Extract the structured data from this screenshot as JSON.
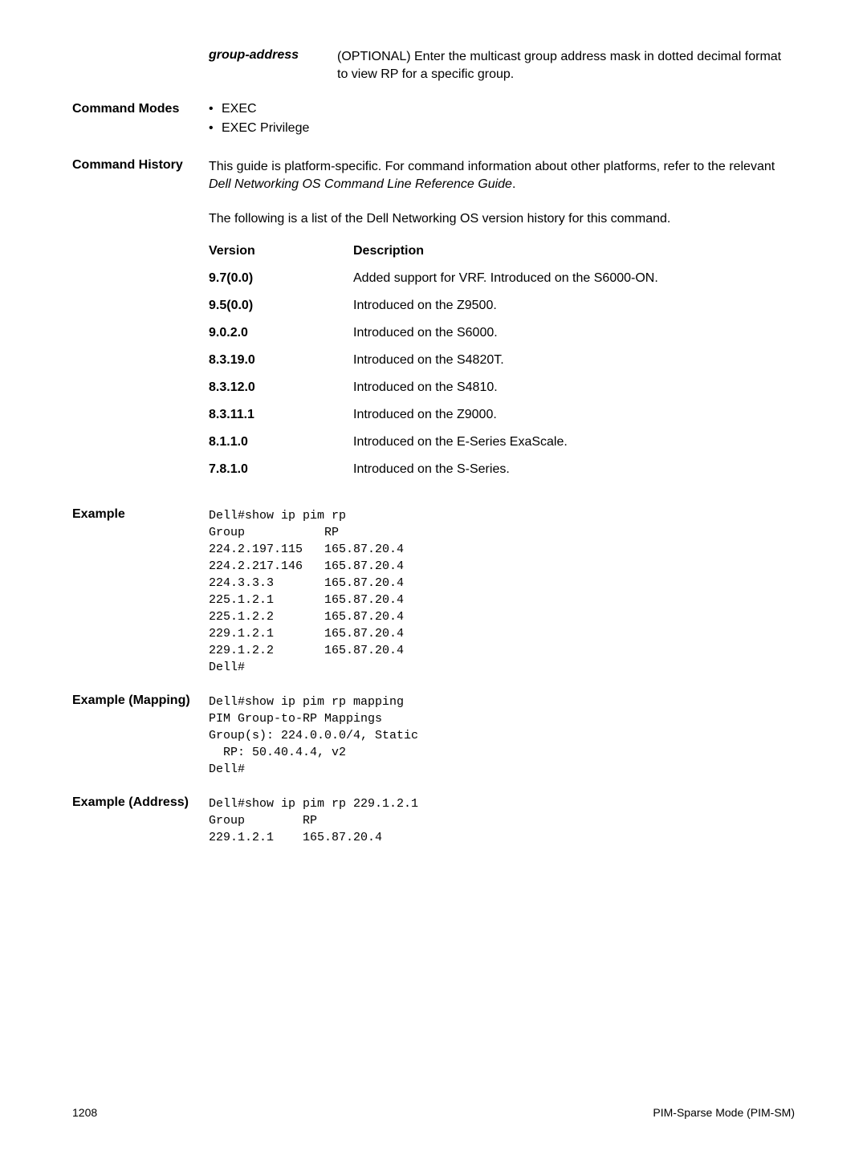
{
  "param": {
    "name": "group-address",
    "desc": "(OPTIONAL) Enter the multicast group address mask in dotted decimal format to view RP for a specific group."
  },
  "modes": {
    "label": "Command Modes",
    "items": [
      "EXEC",
      "EXEC Privilege"
    ]
  },
  "history": {
    "label": "Command History",
    "intro1": "This guide is platform-specific. For command information about other platforms, refer to the relevant ",
    "intro1_italic": "Dell Networking OS Command Line Reference Guide",
    "intro1_end": ".",
    "intro2": "The following is a list of the Dell Networking OS version history for this command.",
    "header_version": "Version",
    "header_desc": "Description",
    "rows": [
      {
        "v": "9.7(0.0)",
        "d": "Added support for VRF. Introduced on the S6000-ON."
      },
      {
        "v": "9.5(0.0)",
        "d": "Introduced on the Z9500."
      },
      {
        "v": "9.0.2.0",
        "d": "Introduced on the S6000."
      },
      {
        "v": "8.3.19.0",
        "d": "Introduced on the S4820T."
      },
      {
        "v": "8.3.12.0",
        "d": "Introduced on the S4810."
      },
      {
        "v": "8.3.11.1",
        "d": "Introduced on the Z9000."
      },
      {
        "v": "8.1.1.0",
        "d": "Introduced on the E-Series ExaScale."
      },
      {
        "v": "7.8.1.0",
        "d": "Introduced on the S-Series."
      }
    ]
  },
  "example": {
    "label": "Example",
    "code": "Dell#show ip pim rp\nGroup           RP\n224.2.197.115   165.87.20.4\n224.2.217.146   165.87.20.4\n224.3.3.3       165.87.20.4\n225.1.2.1       165.87.20.4\n225.1.2.2       165.87.20.4\n229.1.2.1       165.87.20.4\n229.1.2.2       165.87.20.4\nDell#"
  },
  "example_mapping": {
    "label": "Example (Mapping)",
    "code": "Dell#show ip pim rp mapping\nPIM Group-to-RP Mappings\nGroup(s): 224.0.0.0/4, Static\n  RP: 50.40.4.4, v2\nDell#"
  },
  "example_address": {
    "label": "Example (Address)",
    "code": "Dell#show ip pim rp 229.1.2.1\nGroup        RP\n229.1.2.1    165.87.20.4"
  },
  "footer": {
    "page": "1208",
    "section": "PIM-Sparse Mode (PIM-SM)"
  }
}
